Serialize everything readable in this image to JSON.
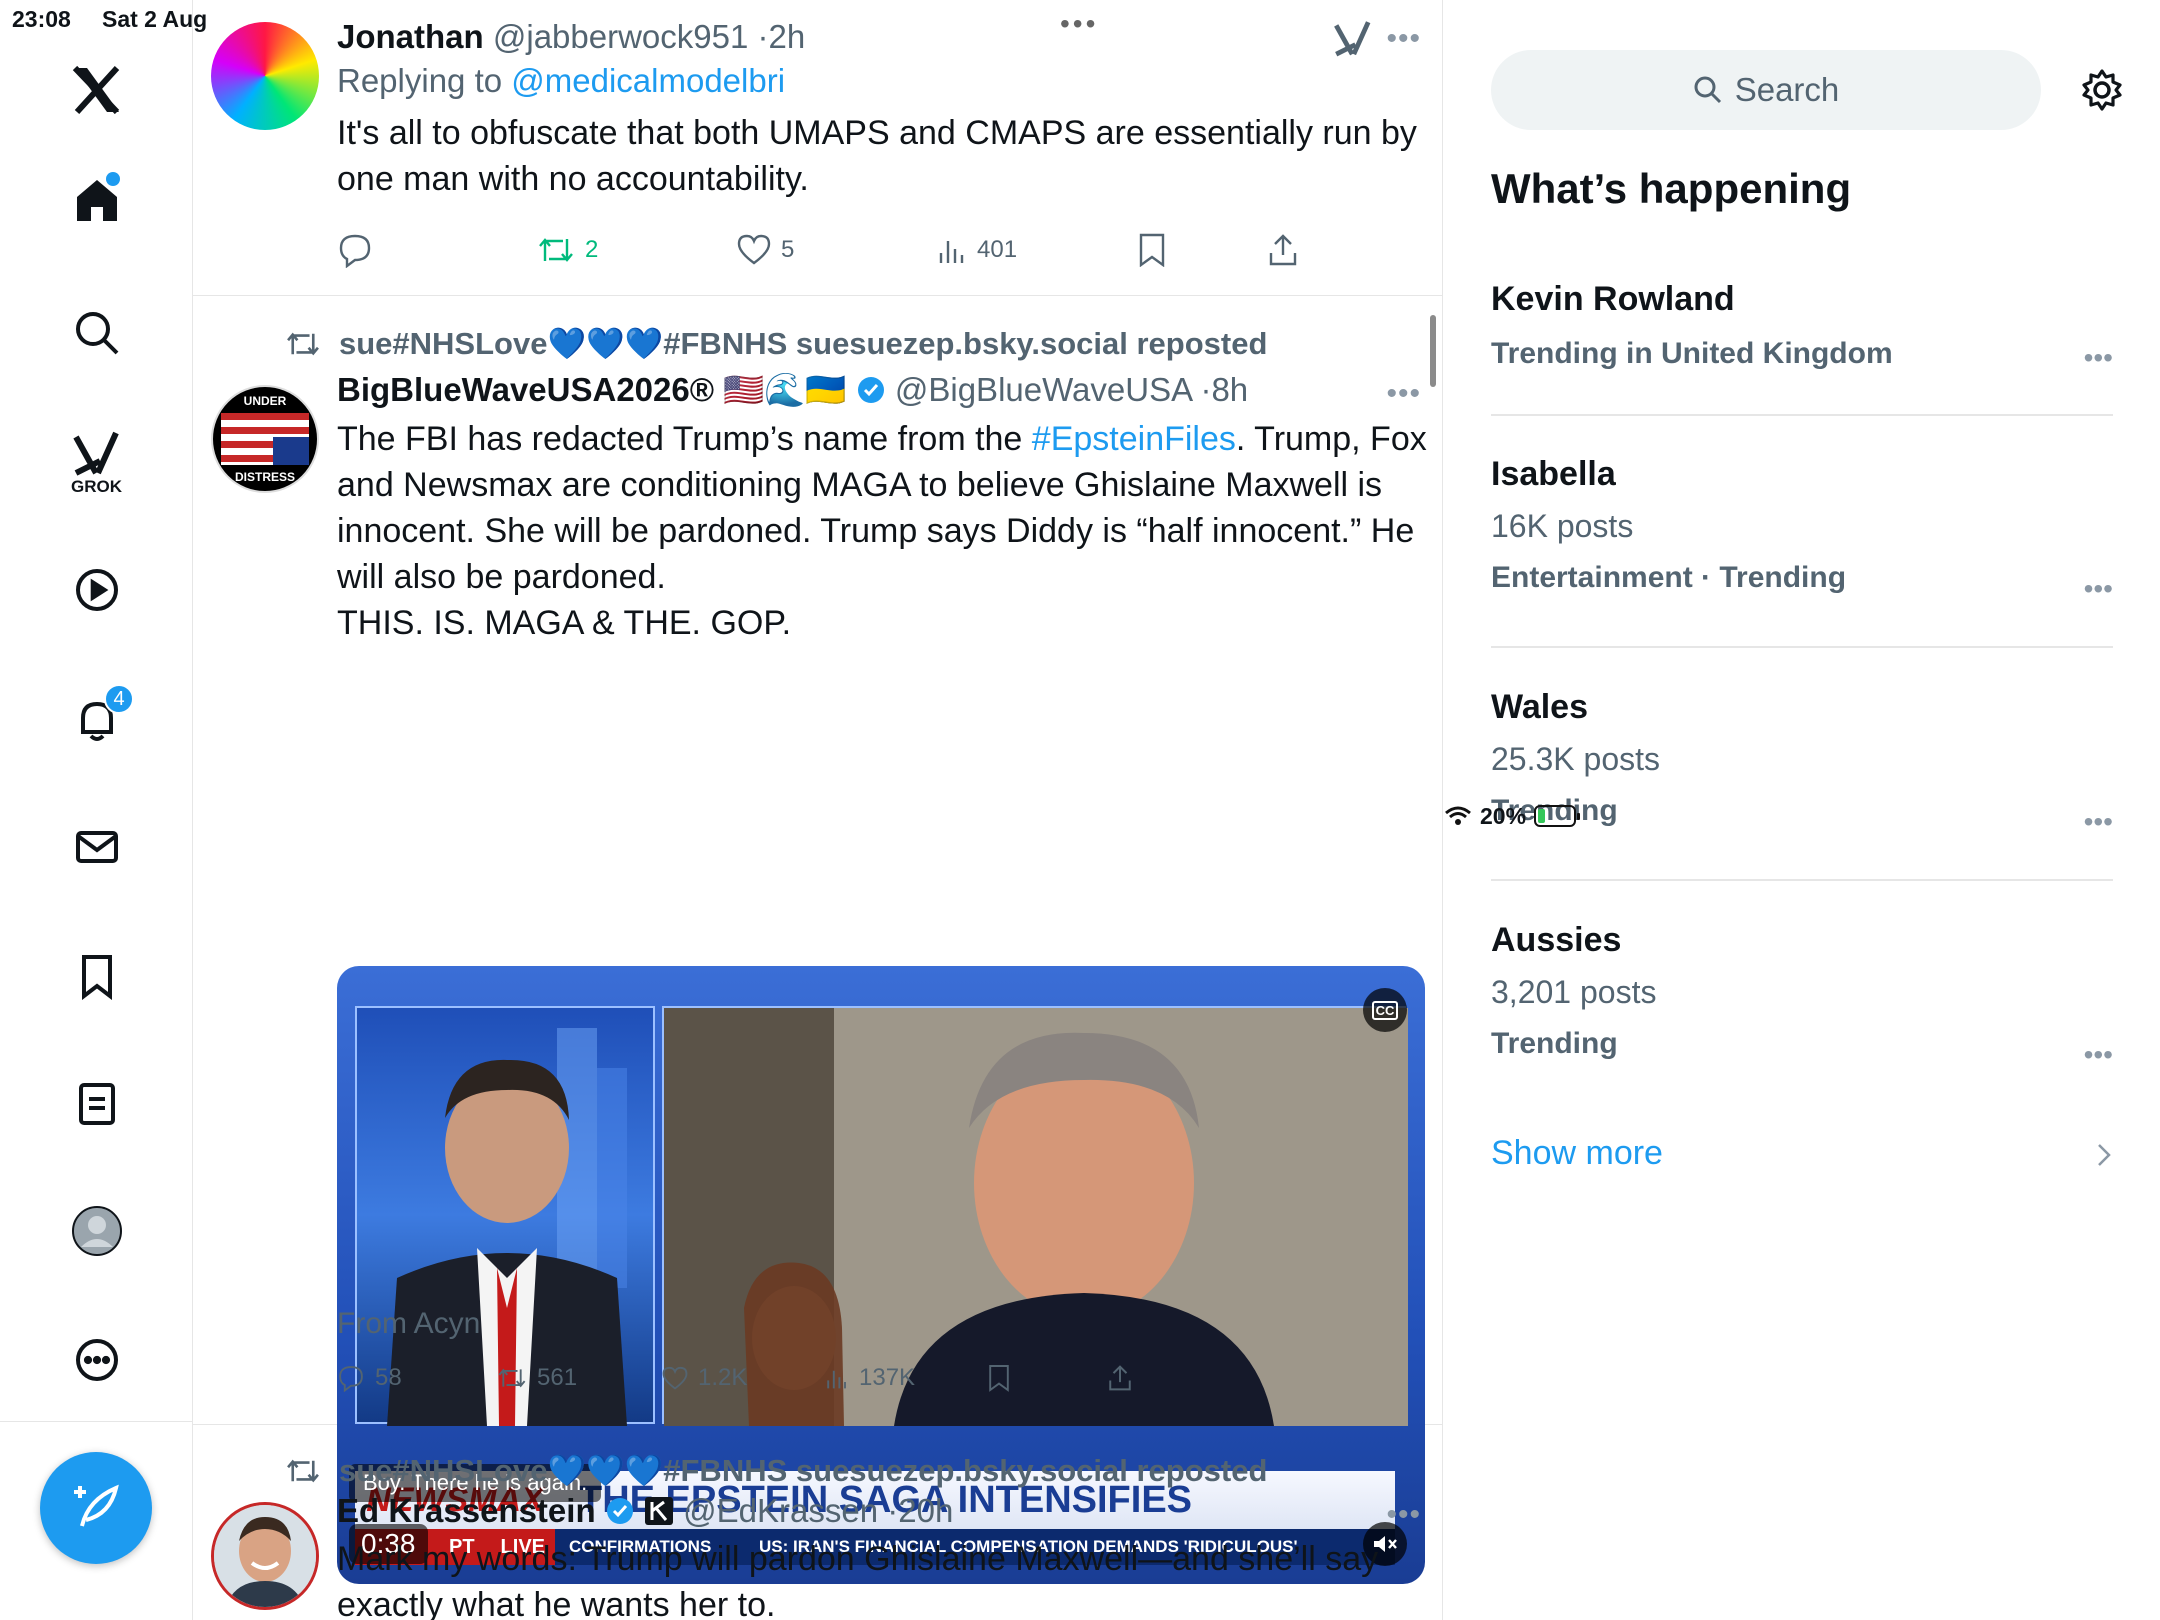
{
  "status_bar": {
    "time": "23:08",
    "date": "Sat 2 Aug",
    "battery": "20%"
  },
  "sidebar": {
    "grok_label": "GROK",
    "notifications_badge": "4"
  },
  "tweets": [
    {
      "name": "Jonathan",
      "handle": "@jabberwock951",
      "time": "2h",
      "replying_to_prefix": "Replying to ",
      "replying_to": "@medicalmodelbri",
      "text": "It's all to obfuscate that both UMAPS and CMAPS are essentially run by one man with no accountability.",
      "retweets": "2",
      "likes": "5",
      "views": "401"
    },
    {
      "reposted_by": "sue#NHSLove💙💙💙#FBNHS suesuezep.bsky.social reposted",
      "name": "BigBlueWaveUSA2026®",
      "flags": "🇺🇸🌊🇺🇦",
      "handle": "@BigBlueWaveUSA",
      "time": "8h",
      "text_before": "The FBI has redacted Trump’s name from the ",
      "hashtag": "#EpsteinFiles",
      "text_after": ". Trump, Fox and Newsmax are conditioning MAGA to believe Ghislaine Maxwell is innocent. She will be pardoned. Trump says Diddy is “half innocent.” He will also be pardoned.",
      "text_last": "THIS. IS. MAGA & THE. GOP.",
      "media": {
        "caption": "Boy. There he is again.",
        "duration": "0:38",
        "channel": "NEWSMAX",
        "headline": "THE EPSTEIN SAGA INTENSIFIES",
        "live": "LIVE",
        "pt": "PT",
        "ticker_left": "CONFIRMATIONS",
        "ticker": "US: IRAN'S FINANCIAL COMPENSATION DEMANDS 'RIDICULOUS'",
        "cc": "CC",
        "avatar_top": "UNDER",
        "avatar_bottom": "DISTRESS"
      },
      "source": "From Acyn",
      "replies": "58",
      "retweets": "561",
      "likes": "1.2K",
      "views": "137K"
    },
    {
      "reposted_by": "sue#NHSLove💙💙💙#FBNHS suesuezep.bsky.social reposted",
      "name": "Ed Krassenstein",
      "handle": "@EdKrassen",
      "time": "20h",
      "text": "Mark my words: Trump will pardon Ghislaine Maxwell—and she’ll say exactly what he wants her to."
    }
  ],
  "right": {
    "search_placeholder": "Search",
    "heading": "What’s happening",
    "trends": [
      {
        "title": "Kevin Rowland",
        "meta": "Trending in United Kingdom"
      },
      {
        "title": "Isabella",
        "count": "16K posts",
        "meta": "Entertainment · Trending"
      },
      {
        "title": "Wales",
        "count": "25.3K posts",
        "meta": "Trending"
      },
      {
        "title": "Aussies",
        "count": "3,201 posts",
        "meta": "Trending"
      }
    ],
    "show_more": "Show more"
  },
  "colors": {
    "accent": "#1d9bf0",
    "retweet_active": "#00ba7c",
    "secondary_text": "#536471"
  }
}
